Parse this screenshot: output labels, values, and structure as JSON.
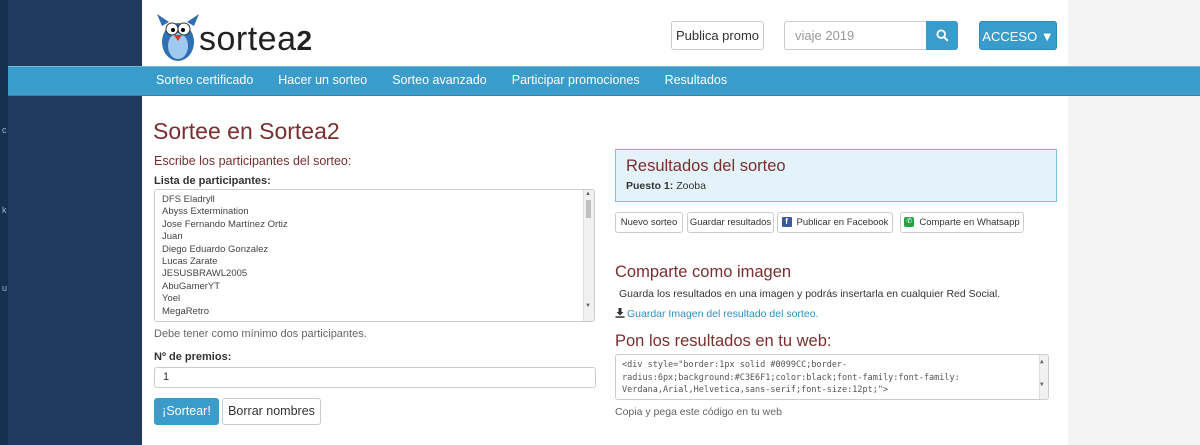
{
  "header": {
    "logo_text": "sortea",
    "logo_number": "2",
    "promo_button": "Publica promo",
    "search_placeholder": "viaje 2019",
    "acceso_button": "ACCESO ▼"
  },
  "nav": {
    "items": [
      "Sorteo certificado",
      "Hacer un sorteo",
      "Sorteo avanzado",
      "Participar promociones",
      "Resultados"
    ]
  },
  "main": {
    "title": "Sortee en Sortea2",
    "subheading": "Escribe los participantes del sorteo:",
    "participants_label": "Lista de participantes:",
    "participants": [
      "DFS Eladryll",
      "Abyss Extermination",
      "Jose Fernando Martínez Ortiz",
      "Juan",
      "Diego Eduardo Gonzalez",
      "Lucas Zarate",
      "JESUSBRAWL2005",
      "AbuGamerYT",
      "Yoel",
      "MegaRetro"
    ],
    "min_hint": "Debe tener como mínimo dos participantes.",
    "prizes_label": "Nº de premios:",
    "prizes_value": "1",
    "sortear_button": "¡Sortear!",
    "borrar_button": "Borrar nombres"
  },
  "results": {
    "title": "Resultados del sorteo",
    "position_label": "Puesto 1:",
    "winner": "Zooba",
    "buttons": {
      "new": "Nuevo sorteo",
      "save": "Guardar resultados",
      "facebook": "Publicar en Facebook",
      "whatsapp": "Comparte en Whatsapp"
    }
  },
  "share_image": {
    "title": "Comparte como imagen",
    "description": "Guarda los resultados en una imagen y podrás insertarla en cualquier Red Social.",
    "link": "Guardar Imagen del resultado del sorteo."
  },
  "web": {
    "title": "Pon los resultados en tu web:",
    "code_lines": [
      "<div style=\"border:1px solid #0099CC;border-",
      "radius:6px;background:#C3E6F1;color:black;font-family:font-family:",
      "Verdana,Arial,Helvetica,sans-serif;font-size:12pt;\">"
    ],
    "hint": "Copia y pega este código en tu web"
  },
  "colors": {
    "accent": "#3a9ccb",
    "heading": "#7a2f2f",
    "result_bg": "#e3f3f9"
  }
}
